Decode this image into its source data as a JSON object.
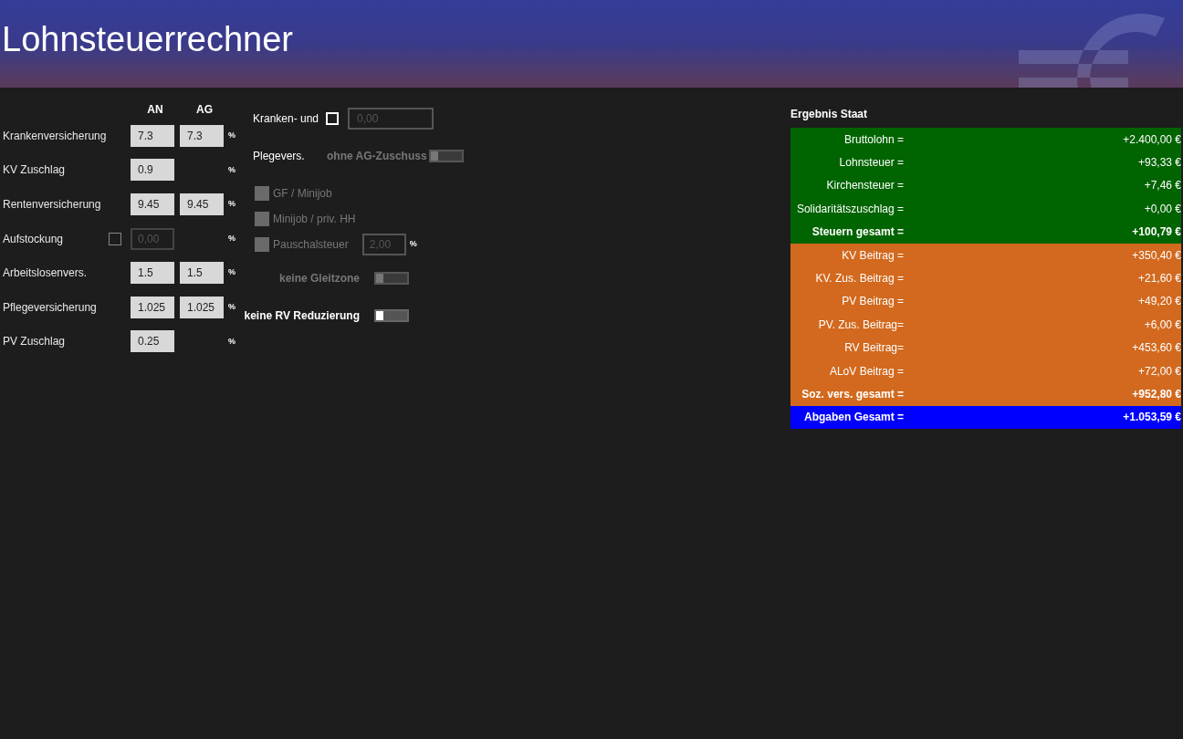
{
  "header": {
    "title": "Lohnsteuerrechner"
  },
  "rates": {
    "columns": [
      "AN",
      "AG"
    ],
    "unit": "%",
    "rows": [
      {
        "label": "Krankenversicherung",
        "an": "7.3",
        "ag": "7.3"
      },
      {
        "label": "KV Zuschlag",
        "an": "0.9"
      },
      {
        "label": "Rentenversicherung",
        "an": "9.45",
        "ag": "9.45"
      },
      {
        "label": "Aufstockung",
        "checkbox": {
          "checked": false
        },
        "an_placeholder": "0,00"
      },
      {
        "label": "Arbeitslosenvers.",
        "an": "1.5",
        "ag": "1.5"
      },
      {
        "label": "Pflegeversicherung",
        "an": "1.025",
        "ag": "1.025"
      },
      {
        "label": "PV Zuschlag",
        "an": "0.25"
      }
    ]
  },
  "options": {
    "kranken_label": "Kranken- und",
    "kranken_checked": false,
    "kranken_placeholder": "0,00",
    "pflege_label": "Plegevers.",
    "ohne_ag": {
      "label": "ohne AG-Zuschuss",
      "on": false,
      "disabled": true
    },
    "checks": [
      {
        "label": "GF / Minijob",
        "checked": false,
        "disabled": true
      },
      {
        "label": "Minijob / priv. HH",
        "checked": false,
        "disabled": true
      },
      {
        "label": "Pauschalsteuer",
        "checked": false,
        "disabled": true,
        "placeholder": "2,00",
        "unit": "%"
      }
    ],
    "toggles": [
      {
        "label": "keine Gleitzone",
        "on": false,
        "disabled": true
      },
      {
        "label": "keine RV Reduzierung",
        "on": false,
        "disabled": false
      }
    ]
  },
  "result": {
    "title": "Ergebnis Staat",
    "groups": [
      {
        "color": "#006400",
        "rows": [
          {
            "label": "Bruttolohn =",
            "value": "+2.400,00 €",
            "bold": false
          },
          {
            "label": "Lohnsteuer =",
            "value": "+93,33 €",
            "bold": false
          },
          {
            "label": "Kirchensteuer =",
            "value": "+7,46 €",
            "bold": false
          },
          {
            "label": "Solidaritätszuschlag =",
            "value": "+0,00 €",
            "bold": false
          },
          {
            "label": "Steuern gesamt =",
            "value": "+100,79 €",
            "bold": true
          }
        ]
      },
      {
        "color": "#d2691e",
        "rows": [
          {
            "label": "KV Beitrag =",
            "value": "+350,40 €",
            "bold": false
          },
          {
            "label": "KV. Zus. Beitrag =",
            "value": "+21,60 €",
            "bold": false
          },
          {
            "label": "PV Beitrag =",
            "value": "+49,20 €",
            "bold": false
          },
          {
            "label": "PV. Zus. Beitrag=",
            "value": "+6,00 €",
            "bold": false
          },
          {
            "label": "RV Beitrag=",
            "value": "+453,60 €",
            "bold": false
          },
          {
            "label": "ALoV Beitrag =",
            "value": "+72,00 €",
            "bold": false
          },
          {
            "label": "Soz. vers. gesamt =",
            "value": "+952,80 €",
            "bold": true
          }
        ]
      },
      {
        "color": "#0000ff",
        "rows": [
          {
            "label": "Abgaben Gesamt =",
            "value": "+1.053,59 €",
            "bold": true
          }
        ]
      }
    ]
  }
}
